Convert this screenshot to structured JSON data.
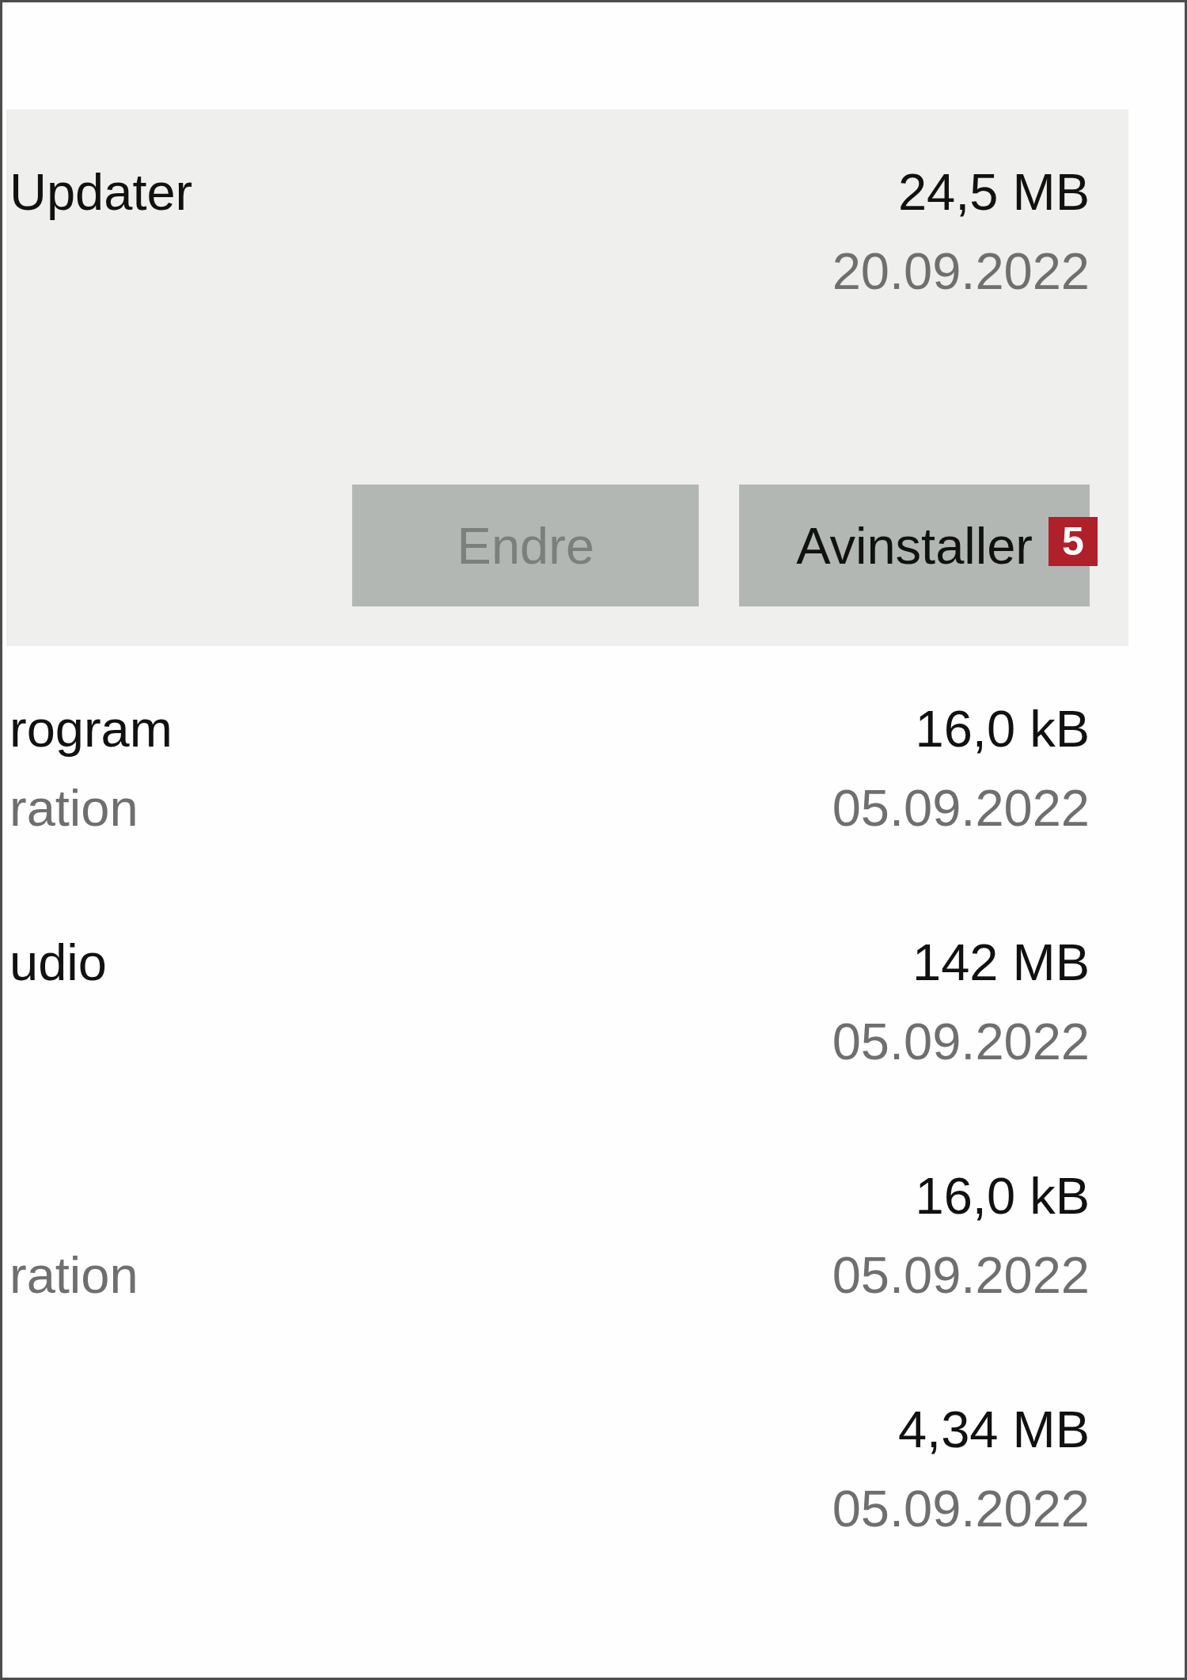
{
  "apps": [
    {
      "name": "Updater",
      "size": "24,5 MB",
      "date": "20.09.2022",
      "selected": true,
      "buttons": [
        {
          "label": "Endre",
          "disabled": true
        },
        {
          "label": "Avinstaller",
          "disabled": false,
          "marker": "5"
        }
      ]
    },
    {
      "name": "rogram",
      "publisher": "ration",
      "size": "16,0 kB",
      "date": "05.09.2022",
      "selected": false
    },
    {
      "name": "udio",
      "size": "142 MB",
      "date": "05.09.2022",
      "selected": false
    },
    {
      "publisher": "ration",
      "size": "16,0 kB",
      "date": "05.09.2022",
      "selected": false
    },
    {
      "size": "4,34 MB",
      "date": "05.09.2022",
      "selected": false
    }
  ]
}
